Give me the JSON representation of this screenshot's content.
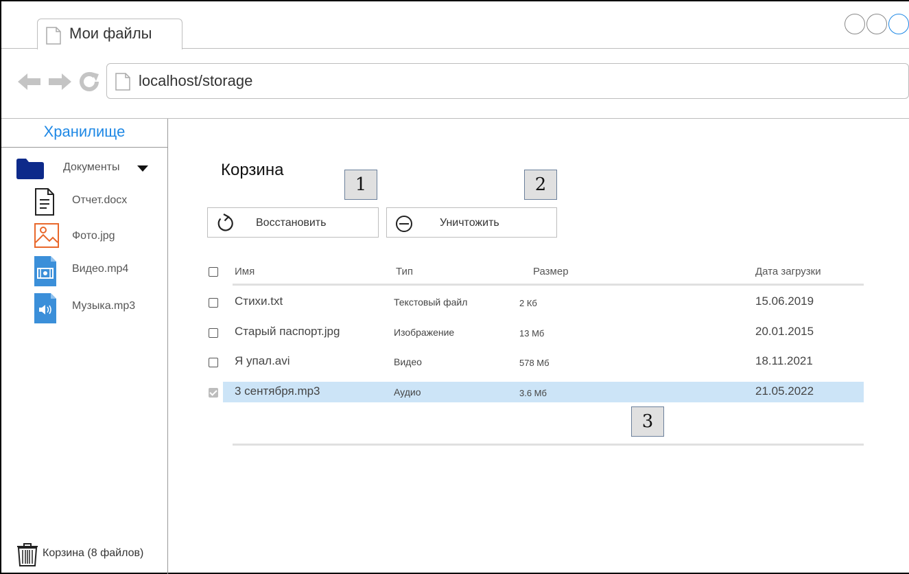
{
  "browser": {
    "tab_title": "Мои файлы",
    "url": "localhost/storage"
  },
  "sidebar": {
    "title": "Хранилище",
    "folder": {
      "label": "Документы",
      "icon": "folder-icon"
    },
    "files": [
      {
        "label": "Отчет.docx",
        "icon": "document-icon"
      },
      {
        "label": "Фото.jpg",
        "icon": "image-icon"
      },
      {
        "label": "Видео.mp4",
        "icon": "video-file-icon"
      },
      {
        "label": "Музыка.mp3",
        "icon": "audio-file-icon"
      }
    ],
    "trash_label": "Корзина (8 файлов)"
  },
  "main": {
    "title": "Корзина",
    "restore_label": "Восстановить",
    "destroy_label": "Уничтожить",
    "markers": [
      "1",
      "2",
      "3"
    ],
    "columns": [
      "Имя",
      "Тип",
      "Размер",
      "Дата загрузки"
    ],
    "rows": [
      {
        "name": "Стихи.txt",
        "type": "Текстовый файл",
        "size": "2 Кб",
        "date": "15.06.2019",
        "checked": false
      },
      {
        "name": "Старый паспорт.jpg",
        "type": "Изображение",
        "size": "13 Мб",
        "date": "20.01.2015",
        "checked": false
      },
      {
        "name": "Я упал.avi",
        "type": "Видео",
        "size": "578 Мб",
        "date": "18.11.2021",
        "checked": false
      },
      {
        "name": "3 сентября.mp3",
        "type": "Аудио",
        "size": "3.6 Мб",
        "date": "21.05.2022",
        "checked": true
      }
    ]
  },
  "colors": {
    "accent": "#1e88e5",
    "selected_row": "#cce4f7",
    "folder": "#0d2a8a",
    "image_icon": "#e8672a",
    "media_icon": "#3b8fd9"
  }
}
